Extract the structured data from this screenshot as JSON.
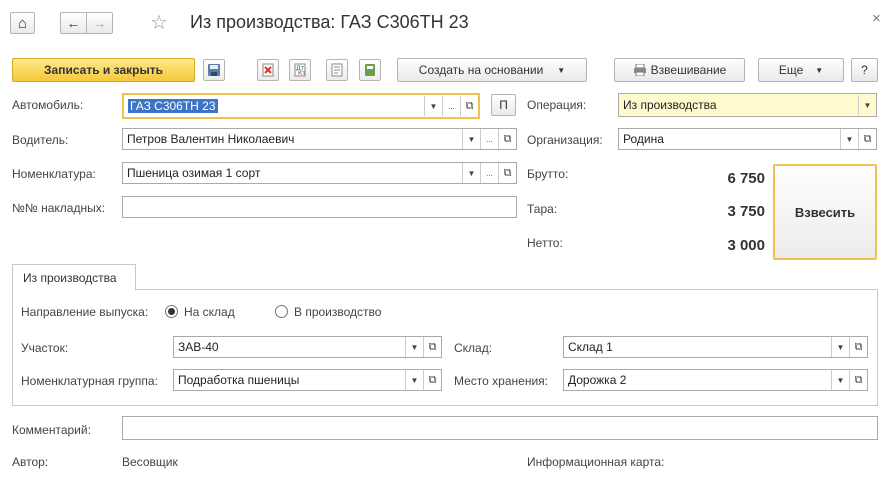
{
  "window": {
    "title": "Из производства: ГАЗ С306ТН 23",
    "close_glyph": "×",
    "home_glyph": "⌂",
    "back_glyph": "←",
    "forward_glyph": "→",
    "star_glyph": "☆"
  },
  "toolbar": {
    "save_close_label": "Записать и закрыть",
    "create_based_label": "Создать на основании",
    "weighing_label": "Взвешивание",
    "more_label": "Еще",
    "help_label": "?"
  },
  "form": {
    "car_label": "Автомобиль:",
    "car_value": "ГАЗ С306ТН 23",
    "car_extra_btn": "П",
    "driver_label": "Водитель:",
    "driver_value": "Петров Валентин Николаевич",
    "nomenclature_label": "Номенклатура:",
    "nomenclature_value": "Пшеница озимая 1 сорт",
    "invoices_label": "№№ накладных:",
    "invoices_value": "",
    "operation_label": "Операция:",
    "operation_value": "Из производства",
    "organization_label": "Организация:",
    "organization_value": "Родина",
    "gross_label": "Брутто:",
    "gross_value": "6 750",
    "tare_label": "Тара:",
    "tare_value": "3 750",
    "net_label": "Нетто:",
    "net_value": "3 000",
    "weigh_button": "Взвесить"
  },
  "tab": {
    "label": "Из производства",
    "direction_label": "Направление выпуска:",
    "direction_option1": "На склад",
    "direction_option2": "В производство",
    "direction_selected": "На склад",
    "section_label": "Участок:",
    "section_value": "ЗАВ-40",
    "warehouse_label": "Склад:",
    "warehouse_value": "Склад 1",
    "nomgroup_label": "Номенклатурная группа:",
    "nomgroup_value": "Подработка пшеницы",
    "storage_label": "Место хранения:",
    "storage_value": "Дорожка 2"
  },
  "footer": {
    "comment_label": "Комментарий:",
    "comment_value": "",
    "author_label": "Автор:",
    "author_value": "Весовщик",
    "info_card_label": "Информационная карта:"
  },
  "glyphs": {
    "dropdown": "▼",
    "ellipsis": "...",
    "open": "⧉"
  }
}
